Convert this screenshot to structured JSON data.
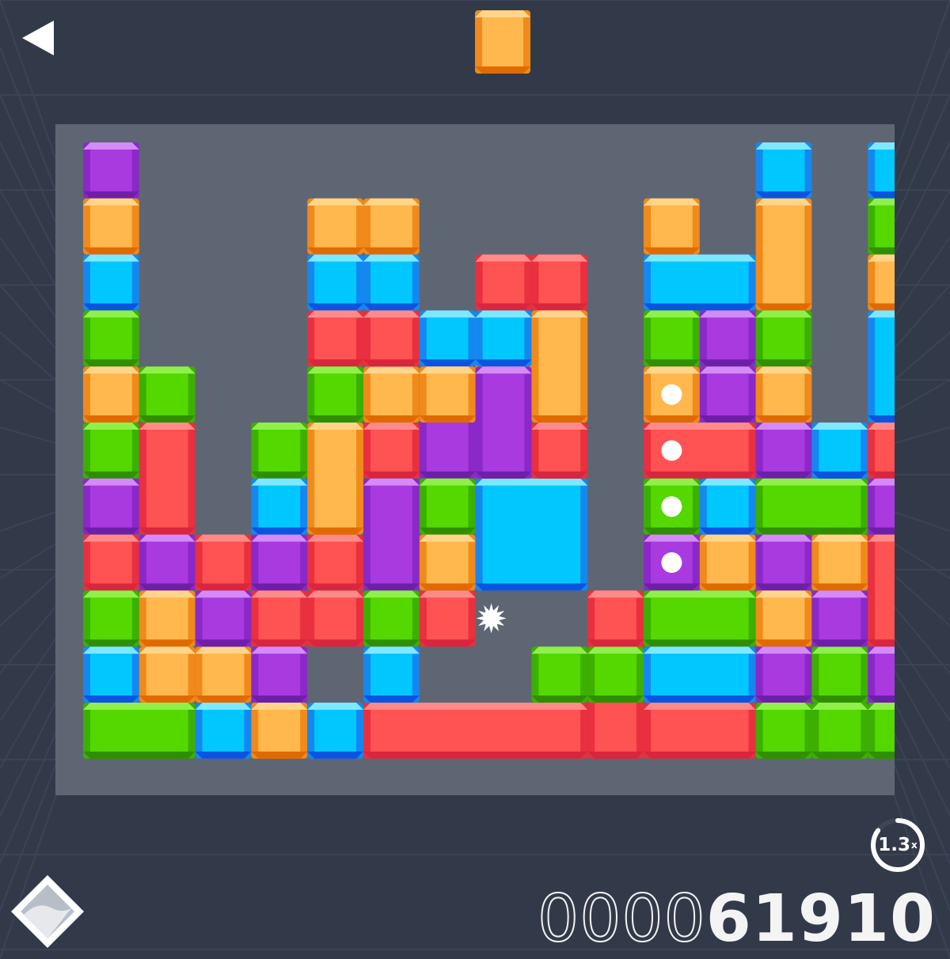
{
  "header": {
    "back_icon": "back-triangle-icon",
    "next_piece": {
      "color": "orange"
    }
  },
  "board": {
    "cols": 14,
    "rows": 11,
    "pieces": [
      {
        "color": "purple",
        "cells": [
          [
            0,
            0
          ]
        ]
      },
      {
        "color": "orange",
        "cells": [
          [
            0,
            1
          ]
        ]
      },
      {
        "color": "blue",
        "cells": [
          [
            0,
            2
          ]
        ]
      },
      {
        "color": "green",
        "cells": [
          [
            0,
            3
          ]
        ]
      },
      {
        "color": "orange",
        "cells": [
          [
            0,
            4
          ]
        ]
      },
      {
        "color": "green",
        "cells": [
          [
            0,
            5
          ]
        ]
      },
      {
        "color": "purple",
        "cells": [
          [
            0,
            6
          ]
        ]
      },
      {
        "color": "red",
        "cells": [
          [
            0,
            7
          ]
        ]
      },
      {
        "color": "green",
        "cells": [
          [
            0,
            8
          ]
        ]
      },
      {
        "color": "blue",
        "cells": [
          [
            0,
            9
          ]
        ]
      },
      {
        "color": "green",
        "cells": [
          [
            0,
            10
          ],
          [
            1,
            10
          ]
        ]
      },
      {
        "color": "green",
        "cells": [
          [
            1,
            4
          ]
        ]
      },
      {
        "color": "red",
        "cells": [
          [
            1,
            5
          ],
          [
            1,
            6
          ]
        ]
      },
      {
        "color": "purple",
        "cells": [
          [
            1,
            7
          ]
        ]
      },
      {
        "color": "orange",
        "cells": [
          [
            1,
            8
          ],
          [
            1,
            9
          ],
          [
            2,
            9
          ]
        ]
      },
      {
        "color": "red",
        "cells": [
          [
            2,
            7
          ]
        ]
      },
      {
        "color": "purple",
        "cells": [
          [
            2,
            8
          ]
        ]
      },
      {
        "color": "blue",
        "cells": [
          [
            2,
            10
          ]
        ]
      },
      {
        "color": "green",
        "cells": [
          [
            3,
            5
          ]
        ]
      },
      {
        "color": "blue",
        "cells": [
          [
            3,
            6
          ]
        ]
      },
      {
        "color": "purple",
        "cells": [
          [
            3,
            7
          ]
        ]
      },
      {
        "color": "red",
        "cells": [
          [
            4,
            7
          ],
          [
            4,
            8
          ],
          [
            3,
            8
          ]
        ]
      },
      {
        "color": "purple",
        "cells": [
          [
            3,
            9
          ]
        ]
      },
      {
        "color": "orange",
        "cells": [
          [
            3,
            10
          ]
        ]
      },
      {
        "color": "orange",
        "cells": [
          [
            4,
            1
          ]
        ]
      },
      {
        "color": "blue",
        "cells": [
          [
            4,
            2
          ]
        ]
      },
      {
        "color": "red",
        "cells": [
          [
            4,
            3
          ]
        ]
      },
      {
        "color": "green",
        "cells": [
          [
            4,
            4
          ]
        ]
      },
      {
        "color": "orange",
        "cells": [
          [
            4,
            5
          ],
          [
            4,
            6
          ]
        ]
      },
      {
        "color": "blue",
        "cells": [
          [
            4,
            10
          ]
        ]
      },
      {
        "color": "orange",
        "cells": [
          [
            5,
            4
          ]
        ]
      },
      {
        "color": "red",
        "cells": [
          [
            5,
            5
          ]
        ]
      },
      {
        "color": "purple",
        "cells": [
          [
            5,
            6
          ],
          [
            5,
            7
          ]
        ]
      },
      {
        "color": "green",
        "cells": [
          [
            5,
            8
          ]
        ]
      },
      {
        "color": "blue",
        "cells": [
          [
            5,
            9
          ]
        ]
      },
      {
        "color": "red",
        "cells": [
          [
            5,
            10
          ],
          [
            6,
            10
          ],
          [
            7,
            10
          ],
          [
            8,
            10
          ]
        ]
      },
      {
        "color": "blue",
        "cells": [
          [
            6,
            3
          ]
        ]
      },
      {
        "color": "purple",
        "cells": [
          [
            6,
            4
          ],
          [
            6,
            5
          ]
        ]
      },
      {
        "color": "green",
        "cells": [
          [
            6,
            6
          ]
        ]
      },
      {
        "color": "orange",
        "cells": [
          [
            6,
            7
          ]
        ]
      },
      {
        "color": "red",
        "cells": [
          [
            6,
            8
          ]
        ]
      },
      {
        "color": "purple",
        "cells": [
          [
            9,
            10
          ]
        ]
      },
      {
        "color": "orange",
        "cells": [
          [
            7,
            3
          ],
          [
            7,
            4
          ]
        ]
      },
      {
        "color": "red",
        "cells": [
          [
            7,
            2
          ]
        ]
      },
      {
        "color": "red",
        "cells": [
          [
            7,
            5
          ]
        ]
      },
      {
        "color": "blue",
        "cells": [
          [
            7,
            6
          ],
          [
            8,
            6
          ],
          [
            7,
            7
          ],
          [
            8,
            7
          ]
        ],
        "special": "burst"
      },
      {
        "color": "green",
        "cells": [
          [
            8,
            9
          ]
        ]
      },
      {
        "color": "red",
        "cells": [
          [
            9,
            8
          ],
          [
            9,
            9
          ],
          [
            9,
            10
          ]
        ]
      },
      {
        "color": "red",
        "cells": [
          [
            10,
            10
          ],
          [
            11,
            10
          ]
        ]
      },
      {
        "color": "orange",
        "cells": [
          [
            10,
            1
          ]
        ]
      },
      {
        "color": "blue",
        "cells": [
          [
            10,
            2
          ],
          [
            11,
            2
          ]
        ]
      },
      {
        "color": "green",
        "cells": [
          [
            10,
            3
          ]
        ]
      },
      {
        "color": "purple",
        "cells": [
          [
            11,
            3
          ]
        ]
      },
      {
        "color": "purple",
        "cells": [
          [
            11,
            4
          ]
        ]
      },
      {
        "color": "orange",
        "cells": [
          [
            10,
            4
          ]
        ],
        "dot": true
      },
      {
        "color": "red",
        "cells": [
          [
            10,
            5
          ],
          [
            11,
            5
          ]
        ],
        "dot": true
      },
      {
        "color": "green",
        "cells": [
          [
            10,
            6
          ]
        ],
        "dot": true
      },
      {
        "color": "purple",
        "cells": [
          [
            10,
            7
          ]
        ],
        "dot": true
      },
      {
        "color": "blue",
        "cells": [
          [
            11,
            6
          ]
        ]
      },
      {
        "color": "orange",
        "cells": [
          [
            11,
            7
          ]
        ]
      },
      {
        "color": "green",
        "cells": [
          [
            10,
            8
          ],
          [
            11,
            8
          ]
        ]
      },
      {
        "color": "blue",
        "cells": [
          [
            10,
            9
          ],
          [
            11,
            9
          ]
        ]
      },
      {
        "color": "blue",
        "cells": [
          [
            12,
            0
          ]
        ]
      },
      {
        "color": "orange",
        "cells": [
          [
            12,
            1
          ],
          [
            12,
            2
          ]
        ]
      },
      {
        "color": "green",
        "cells": [
          [
            12,
            3
          ]
        ]
      },
      {
        "color": "orange",
        "cells": [
          [
            12,
            4
          ]
        ]
      },
      {
        "color": "purple",
        "cells": [
          [
            12,
            5
          ]
        ]
      },
      {
        "color": "green",
        "cells": [
          [
            12,
            6
          ],
          [
            13,
            6
          ]
        ]
      },
      {
        "color": "purple",
        "cells": [
          [
            12,
            7
          ]
        ]
      },
      {
        "color": "orange",
        "cells": [
          [
            12,
            8
          ]
        ]
      },
      {
        "color": "purple",
        "cells": [
          [
            12,
            9
          ]
        ]
      },
      {
        "color": "green",
        "cells": [
          [
            12,
            10
          ],
          [
            13,
            10
          ],
          [
            13,
            9
          ],
          [
            14,
            10
          ]
        ]
      },
      {
        "color": "blue",
        "cells": [
          [
            13,
            5
          ]
        ]
      },
      {
        "color": "orange",
        "cells": [
          [
            13,
            7
          ]
        ]
      },
      {
        "color": "purple",
        "cells": [
          [
            13,
            8
          ]
        ]
      },
      {
        "color": "blue",
        "cells": [
          [
            14,
            0
          ]
        ]
      },
      {
        "color": "green",
        "cells": [
          [
            14,
            1
          ]
        ]
      },
      {
        "color": "orange",
        "cells": [
          [
            14,
            2
          ]
        ]
      },
      {
        "color": "blue",
        "cells": [
          [
            14,
            3
          ],
          [
            14,
            4
          ]
        ]
      },
      {
        "color": "red",
        "cells": [
          [
            14,
            5
          ]
        ]
      },
      {
        "color": "purple",
        "cells": [
          [
            14,
            6
          ]
        ]
      },
      {
        "color": "red",
        "cells": [
          [
            14,
            7
          ],
          [
            14,
            8
          ]
        ]
      },
      {
        "color": "purple",
        "cells": [
          [
            14,
            9
          ]
        ]
      },
      {
        "color": "orange",
        "cells": [
          [
            5,
            1
          ]
        ]
      },
      {
        "color": "blue",
        "cells": [
          [
            5,
            2
          ]
        ]
      },
      {
        "color": "red",
        "cells": [
          [
            5,
            3
          ]
        ]
      },
      {
        "color": "green",
        "cells": [
          [
            5,
            4
          ]
        ]
      },
      {
        "color": "orange",
        "cells": [
          [
            6,
            4
          ]
        ]
      },
      {
        "color": "red",
        "cells": [
          [
            8,
            2
          ]
        ]
      },
      {
        "color": "blue",
        "cells": [
          [
            7,
            3
          ]
        ]
      },
      {
        "color": "orange",
        "cells": [
          [
            8,
            3
          ],
          [
            8,
            4
          ]
        ]
      },
      {
        "color": "purple",
        "cells": [
          [
            7,
            4
          ],
          [
            7,
            5
          ]
        ]
      },
      {
        "color": "red",
        "cells": [
          [
            8,
            5
          ]
        ]
      },
      {
        "color": "green",
        "cells": [
          [
            9,
            9
          ]
        ]
      },
      {
        "color": "red",
        "cells": [
          [
            9,
            8
          ]
        ]
      }
    ]
  },
  "palette": {
    "red": {
      "face": "#ff5252",
      "light": "#ff8a8a",
      "dark": "#d7263d",
      "side": "#e8303f"
    },
    "orange": {
      "face": "#ffb84d",
      "light": "#ffd58a",
      "dark": "#e06a00",
      "side": "#f08a1a"
    },
    "blue": {
      "face": "#00c8ff",
      "light": "#7ee8ff",
      "dark": "#0a55e0",
      "side": "#1488f0"
    },
    "green": {
      "face": "#54d800",
      "light": "#8ff04a",
      "dark": "#2f8f00",
      "side": "#3cb000"
    },
    "purple": {
      "face": "#a93ae0",
      "light": "#d48af8",
      "dark": "#6d1fa8",
      "side": "#8a28c8"
    }
  },
  "multiplier": {
    "value": "1.3",
    "suffix": "x",
    "progress": 0.85
  },
  "score": {
    "prefix": "0000",
    "value": "61910"
  },
  "menu_icon": "diamond-menu-icon"
}
